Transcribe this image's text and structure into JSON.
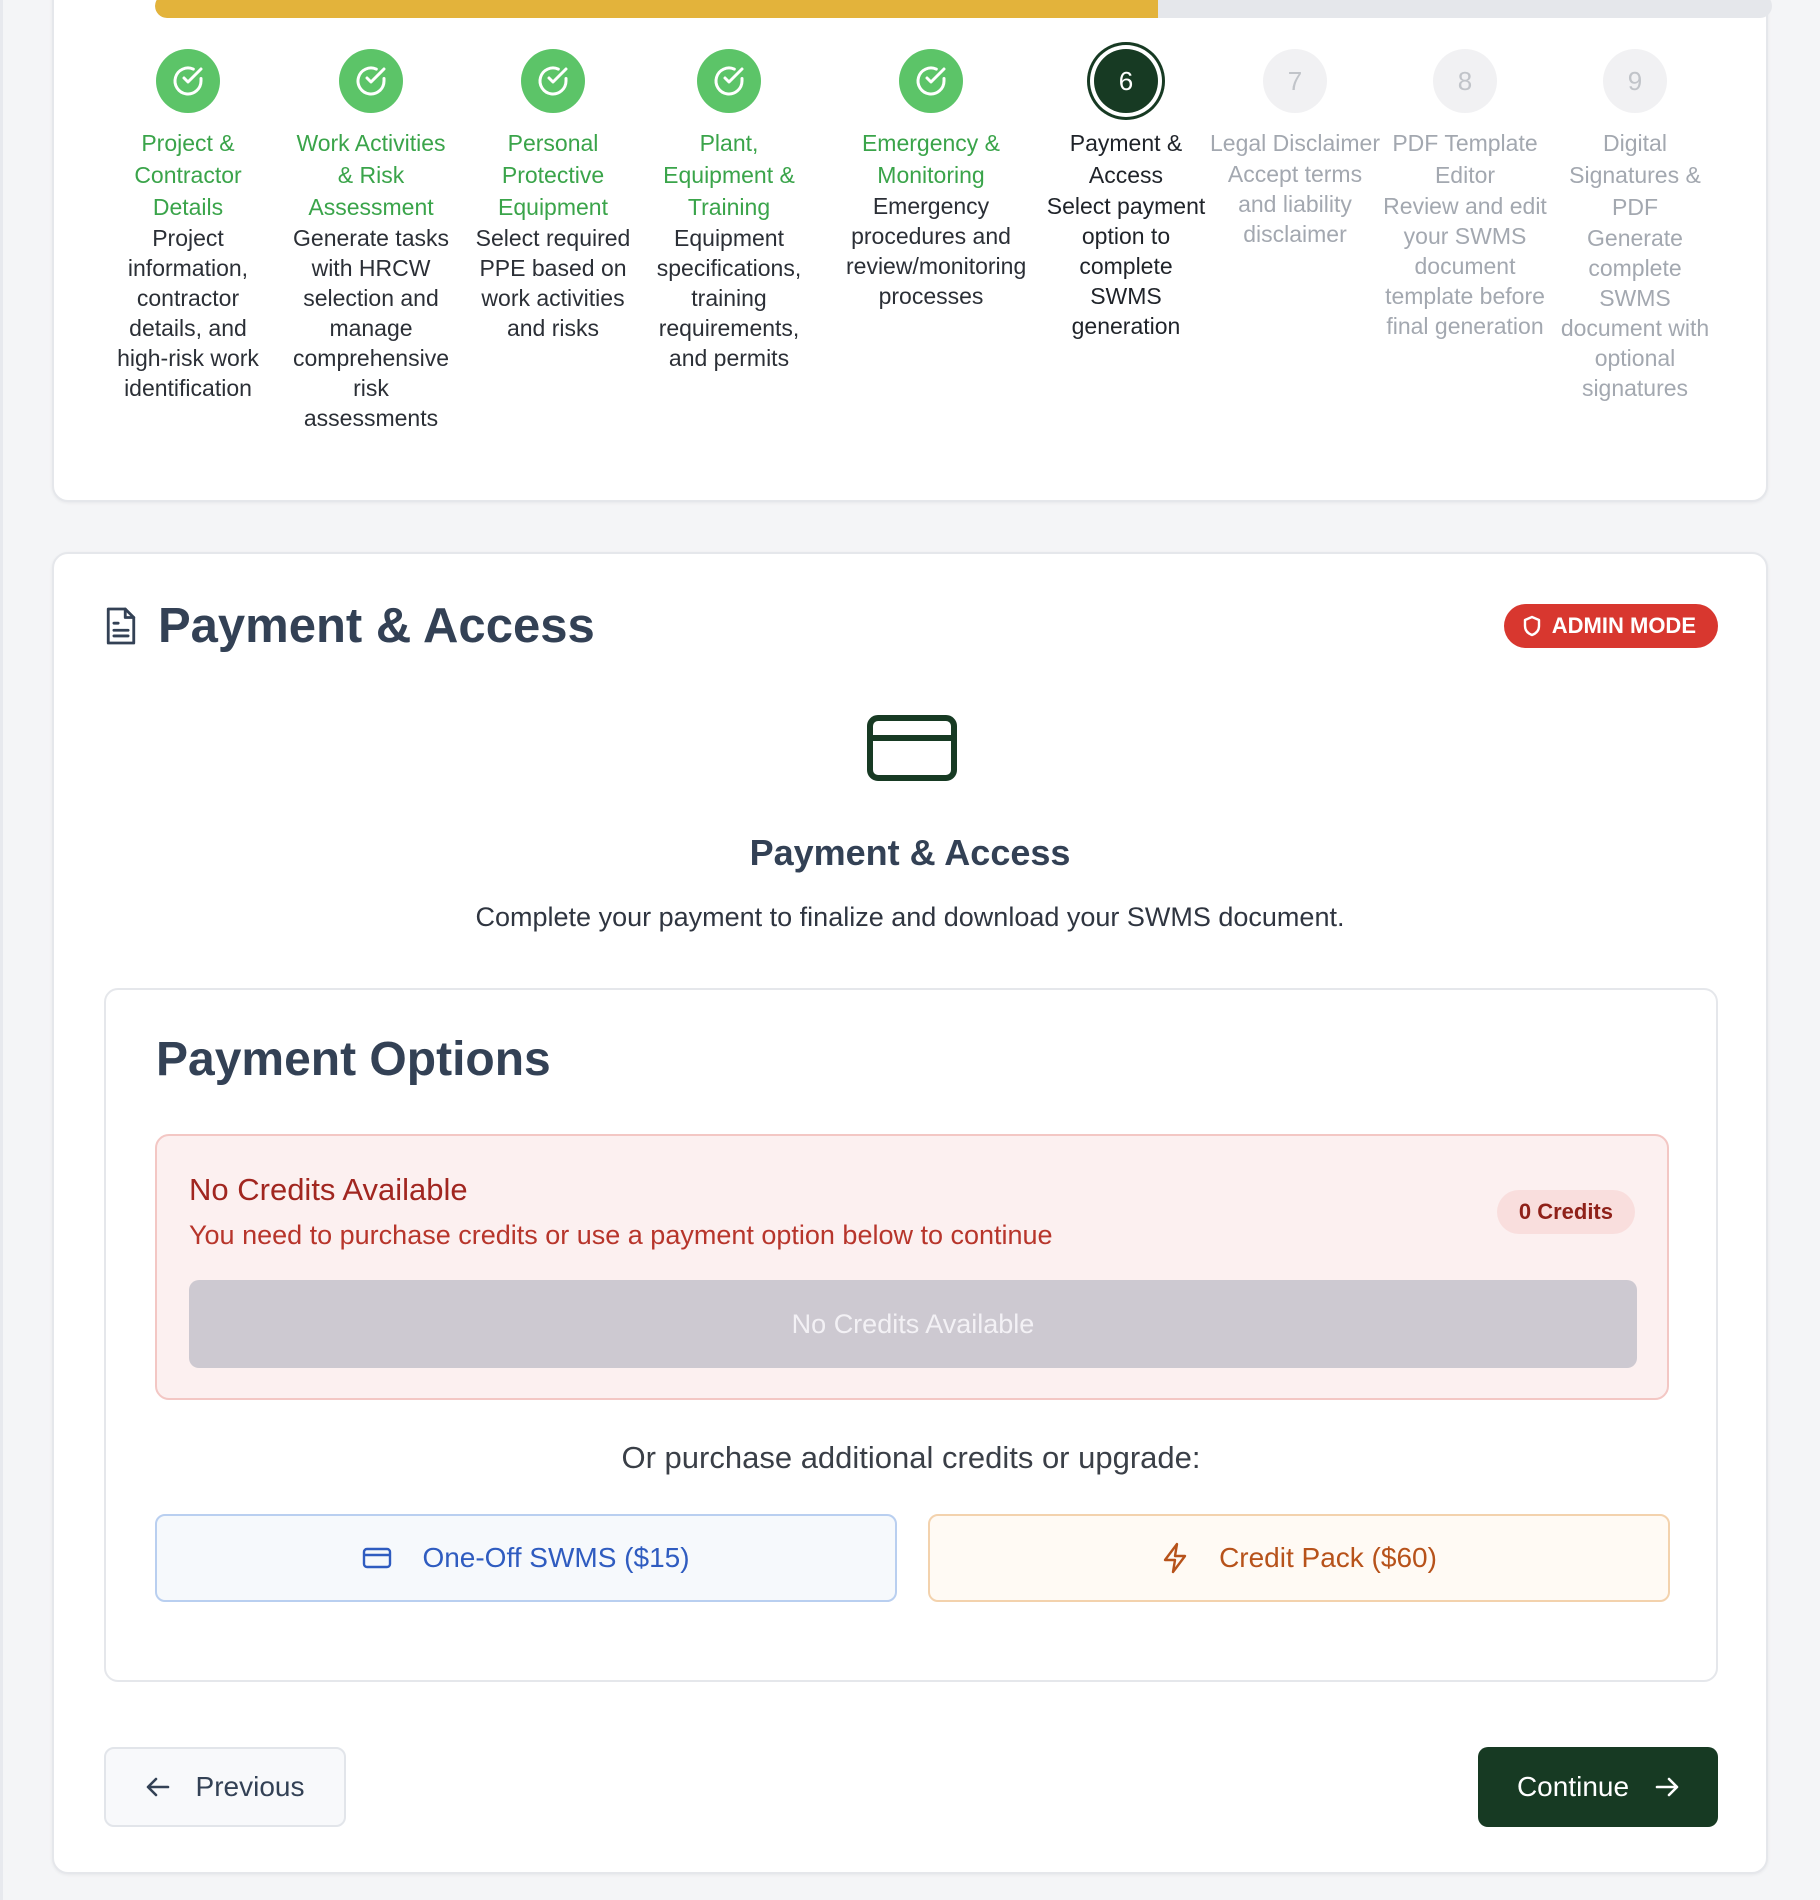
{
  "progress": {
    "percent": 62,
    "fill_color": "#e3b33b",
    "steps": [
      {
        "number": "1",
        "status": "done",
        "title": "Project & Contractor Details",
        "description": "Project information, contractor details, and high-risk work identification"
      },
      {
        "number": "2",
        "status": "done",
        "title": "Work Activities & Risk Assessment",
        "description": "Generate tasks with HRCW selection and manage comprehensive risk assessments"
      },
      {
        "number": "3",
        "status": "done",
        "title": "Personal Protective Equipment",
        "description": "Select required PPE based on work activities and risks"
      },
      {
        "number": "4",
        "status": "done",
        "title": "Plant, Equipment & Training",
        "description": "Equipment specifications, training requirements, and permits"
      },
      {
        "number": "5",
        "status": "done",
        "title": "Emergency & Monitoring",
        "description": "Emergency procedures and review/monitoring processes"
      },
      {
        "number": "6",
        "status": "active",
        "title": "Payment & Access",
        "description": "Select payment option to complete SWMS generation"
      },
      {
        "number": "7",
        "status": "todo",
        "title": "Legal Disclaimer",
        "description": "Accept terms and liability disclaimer"
      },
      {
        "number": "8",
        "status": "todo",
        "title": "PDF Template Editor",
        "description": "Review and edit your SWMS document template before final generation"
      },
      {
        "number": "9",
        "status": "todo",
        "title": "Digital Signatures & PDF",
        "description": "Generate complete SWMS document with optional signatures"
      }
    ]
  },
  "card": {
    "title": "Payment & Access",
    "title_icon": "document-icon",
    "admin_badge": "ADMIN MODE",
    "admin_icon": "shield-icon",
    "hero_icon": "credit-card-icon",
    "center_title": "Payment & Access",
    "center_subtitle": "Complete your payment to finalize and download your SWMS document."
  },
  "payment_options": {
    "title": "Payment Options",
    "alert": {
      "title": "No Credits Available",
      "message": "You need to purchase credits or use a payment option below to continue",
      "badge": "0 Credits",
      "button": "No Credits Available"
    },
    "or_text": "Or purchase additional credits or upgrade:",
    "oneoff_label": "One-Off SWMS ($15)",
    "oneoff_icon": "credit-card-icon",
    "pack_label": "Credit Pack ($60)",
    "pack_icon": "lightning-icon"
  },
  "nav": {
    "previous": "Previous",
    "continue": "Continue"
  },
  "colors": {
    "done_green": "#5cc468",
    "active_dark": "#173a23",
    "admin_red": "#d8372f"
  }
}
